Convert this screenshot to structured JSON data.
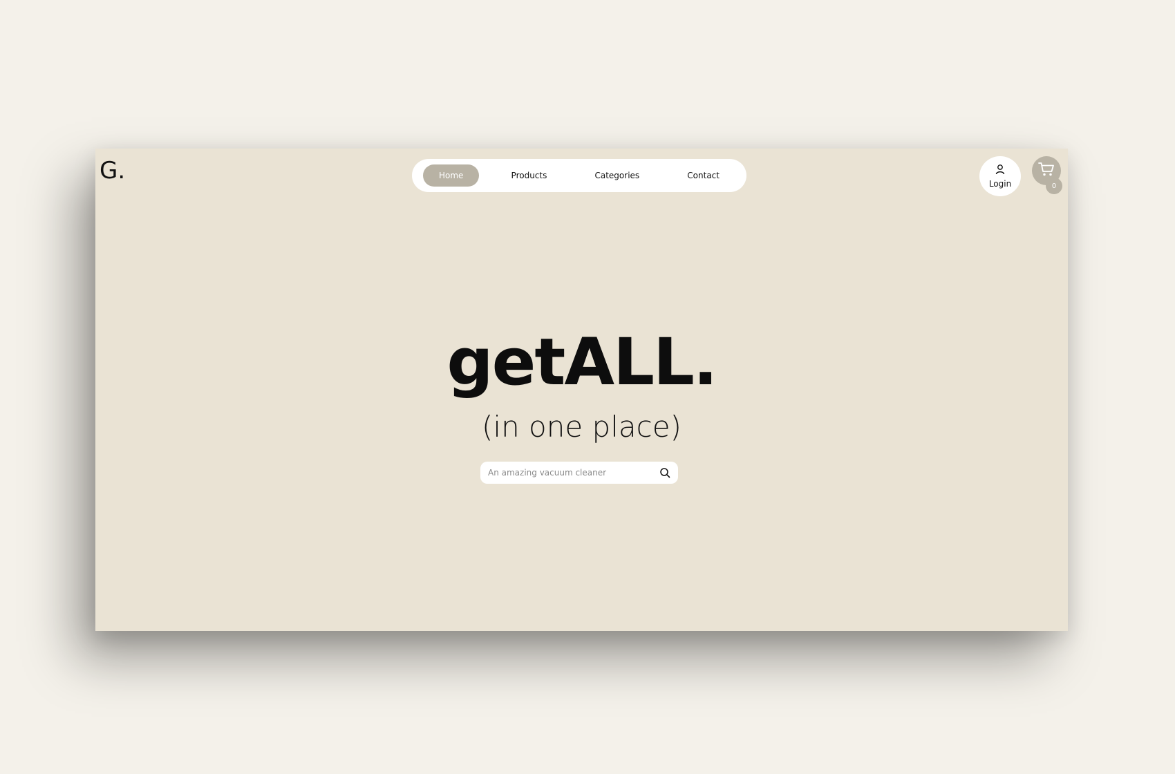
{
  "brand": {
    "logo_text": "G."
  },
  "nav": {
    "items": [
      {
        "label": "Home",
        "active": true
      },
      {
        "label": "Products",
        "active": false
      },
      {
        "label": "Categories",
        "active": false
      },
      {
        "label": "Contact",
        "active": false
      }
    ]
  },
  "account": {
    "login_label": "Login",
    "icon": "user-icon"
  },
  "cart": {
    "icon": "cart-icon",
    "count": "0"
  },
  "hero": {
    "title": "getALL.",
    "subtitle": "(in one place)"
  },
  "search": {
    "placeholder": "An amazing vacuum cleaner",
    "value": "",
    "icon": "search-icon"
  },
  "colors": {
    "page_background": "#f4f1ea",
    "frame_background": "#eae3d4",
    "accent": "#b8b2a4",
    "surface": "#ffffff",
    "text": "#111111"
  }
}
